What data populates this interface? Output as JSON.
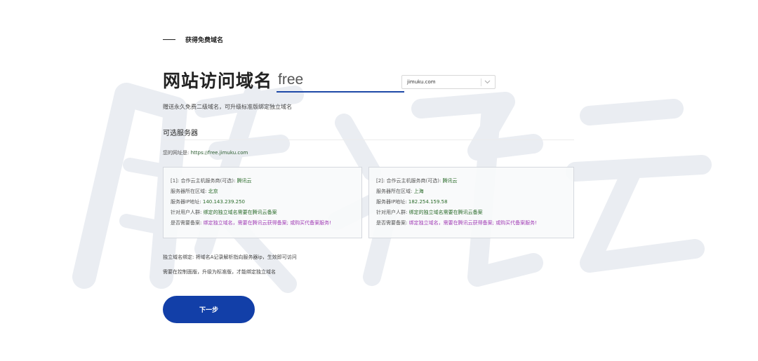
{
  "section_title": "获得免费域名",
  "domain_form": {
    "title": "网站访问域名",
    "subdomain_value": "free",
    "suffix_selected": "jimuku.com",
    "subtitle": "赠送永久免费二级域名，可升级标准版绑定独立域名"
  },
  "servers": {
    "title": "可选服务器",
    "site_url_label": "您的网址是:",
    "site_url": "https://free.jimuku.com",
    "cards": [
      {
        "provider_label": "[1]: 合作云主机服务商(可选):",
        "provider": "腾讯云",
        "region_label": "服务器所在区域:",
        "region": "北京",
        "ip_label": "服务器IP地址:",
        "ip": "140.143.239.250",
        "audience_label": "针对用户人群:",
        "audience": "绑定的独立域名需要在腾讯云备案",
        "filing_label": "是否需要备案:",
        "filing": "绑定独立域名，需要在腾讯云获得备案; 或购买代备案服务!"
      },
      {
        "provider_label": "[2]: 合作云主机服务商(可选):",
        "provider": "腾讯云",
        "region_label": "服务器所在区域:",
        "region": "上海",
        "ip_label": "服务器IP地址:",
        "ip": "182.254.159.58",
        "audience_label": "针对用户人群:",
        "audience": "绑定的独立域名需要在腾讯云备案",
        "filing_label": "是否需要备案:",
        "filing": "绑定独立域名，需要在腾讯云获得备案; 或购买代备案服务!"
      }
    ]
  },
  "notes": [
    "独立域名绑定: 将域名A记录解析指向服务器ip，生效即可访问",
    "需要在控制面版，升级为标准版，才能绑定独立域名"
  ],
  "next_button": "下一步",
  "colors": {
    "accent": "#123fa8",
    "input_underline": "#1e49a7",
    "value_green": "#2a6b2a",
    "value_purple": "#a13db5",
    "watermark": "#e6e9ef"
  }
}
